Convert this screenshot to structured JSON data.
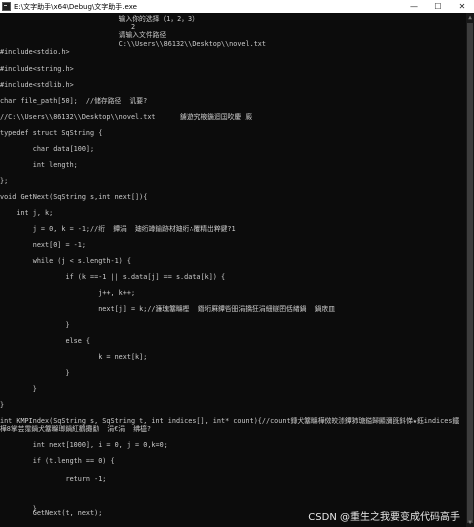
{
  "window": {
    "title": "E:\\文字助手\\x64\\Debug\\文字助手.exe",
    "minimize_glyph": "—",
    "maximize_glyph": "☐",
    "close_glyph": "✕"
  },
  "console": {
    "lines": [
      "                             输入你的选择（1，2，3）",
      "                                2",
      "                             请输入文件路径",
      "                             C:\\\\Users\\\\86132\\\\Desktop\\\\novel.txt",
      "#include<stdio.h>",
      "#include<string.h>",
      "#include<stdlib.h>",
      "char file_path[50];  //储存路径  讥要?",
      "//C:\\\\Users\\\\86132\\\\Desktop\\\\novel.txt      鐪遊究棭鍦迴囯吹慶 廄",
      "typedef struct SqString {",
      "        char data[100];",
      "        int length;",
      "};",
      "void GetNext(SqString s,int next[]){",
      "    int j, k;",
      "        j = 0, k = -1;//绗  鐔涓  廸绗竴鍮跡材廸绗∴覆精岀粹鍵?1",
      "        next[0] = -1;",
      "        while (j < s.length-1) {",
      "                if (k ==-1 || s.data[j] == s.data[k]) {",
      "                        j++, k++;",
      "                        next[j] = k;//濂瑰簺矊樫  鐕垳厤鐔呰昍涓撟狂涓細鐩囨佸緖鍋  鍋庡皿",
      "                }",
      "                else {",
      "                        k = next[k];",
      "                }",
      "        }",
      "}",
      "int KMPIndex(SqString s, SqString t, int indices[], int* count){//count鏄犬簺矊樺傚皎漴鐔犻瑭鎰歸顯瀰旣鈄悌★鈺indices鐵樺8掌芸霪鍋犬簺矊瑯鍋紅鸖攤勫  涓€涓  绋橀?",
      "        int next[1000], i = 0, j = 0,k=0;",
      "        if (t.length == 0) {",
      "                return -1;",
      "        }",
      "        GetNext(t, next);"
    ]
  },
  "watermark": "CSDN @重生之我要变成代码高手"
}
